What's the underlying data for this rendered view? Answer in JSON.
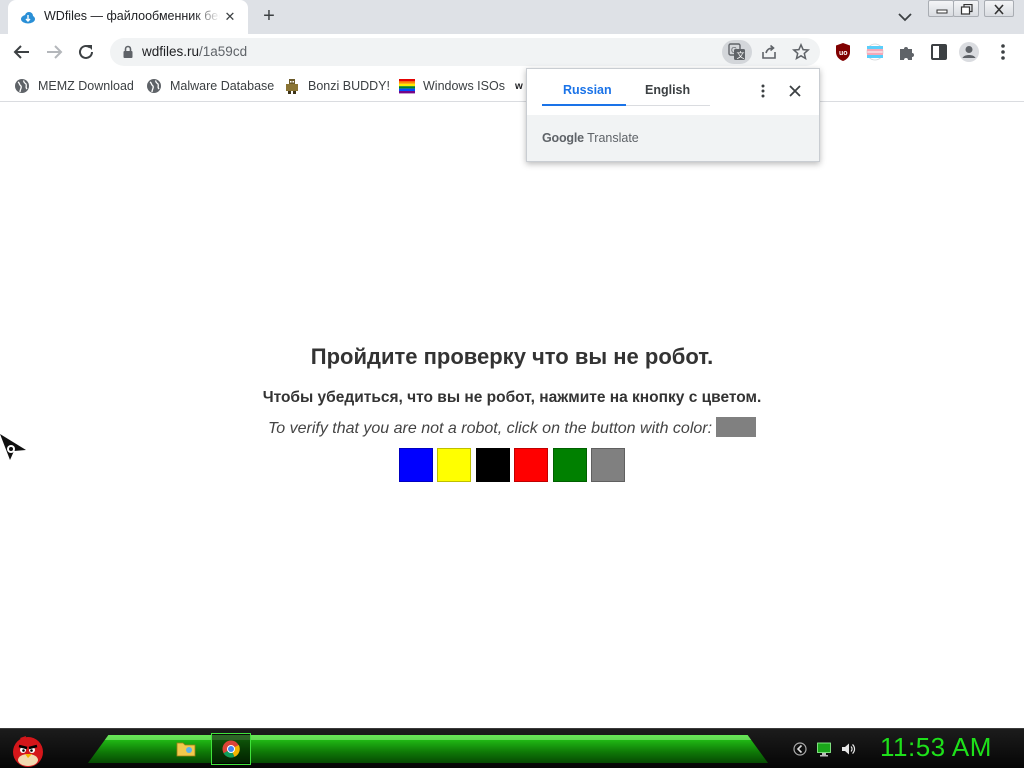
{
  "browser": {
    "tab": {
      "title": "WDfiles — файлообменник бесплатный"
    },
    "url": {
      "domain": "wdfiles.ru",
      "path": "/1a59cd"
    }
  },
  "bookmarks": [
    {
      "label": "MEMZ Download",
      "icon": "globe-icon"
    },
    {
      "label": "Malware Database",
      "icon": "globe-icon"
    },
    {
      "label": "Bonzi BUDDY!",
      "icon": "bonzi-icon"
    },
    {
      "label": "Windows ISOs",
      "icon": "rainbow-flag-icon"
    },
    {
      "label": "w",
      "icon": ""
    }
  ],
  "translate_popup": {
    "source_lang": "Russian",
    "target_lang": "English",
    "brand_google": "Google",
    "brand_translate": "Translate"
  },
  "captcha": {
    "heading": "Пройдите проверку что вы не робот.",
    "instruction_ru": "Чтобы убедиться, что вы не робот, нажмите на кнопку с цветом.",
    "instruction_en": "To verify that you are not a robot, click on the button with color:",
    "target_color": "#808080",
    "buttons": [
      {
        "color": "#0000ff"
      },
      {
        "color": "#ffff00"
      },
      {
        "color": "#000000"
      },
      {
        "color": "#ff0000"
      },
      {
        "color": "#008000"
      },
      {
        "color": "#808080"
      }
    ]
  },
  "taskbar": {
    "clock": "11:53 AM",
    "accent": "#1ee01a"
  },
  "colors": {
    "chrome_frame": "#dee1e6",
    "link_blue": "#1a73e8"
  }
}
